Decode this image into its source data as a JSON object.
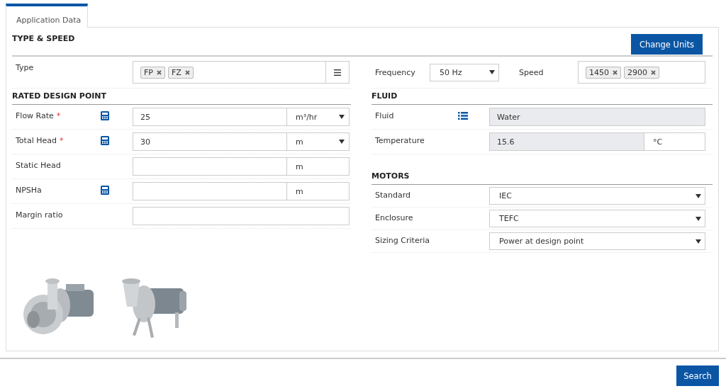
{
  "tabs": [
    {
      "label": "Application Data",
      "selected": true
    }
  ],
  "type_speed": {
    "heading": "TYPE & SPEED",
    "change_units_button": "Change Units",
    "type": {
      "label": "Type",
      "tags": [
        "FP",
        "FZ"
      ]
    },
    "frequency": {
      "label": "Frequency",
      "value": "50 Hz"
    },
    "speed": {
      "label": "Speed",
      "tags": [
        "1450",
        "2900"
      ]
    }
  },
  "rated_design_point": {
    "heading": "RATED DESIGN POINT",
    "rows": [
      {
        "label": "Flow Rate",
        "required_mark": "*",
        "calculator": true,
        "value": "25",
        "unit": "m³/hr",
        "unit_dropdown": true
      },
      {
        "label": "Total Head",
        "required_mark": "*",
        "calculator": true,
        "value": "30",
        "unit": "m",
        "unit_dropdown": true
      },
      {
        "label": "Static Head",
        "calculator": false,
        "unit": "m",
        "unit_dropdown": false
      },
      {
        "label": "NPSHa",
        "calculator": true,
        "unit": "m",
        "unit_dropdown": false
      },
      {
        "label": "Margin ratio",
        "calculator": false
      }
    ]
  },
  "fluid": {
    "heading": "FLUID",
    "rows": [
      {
        "label": "Fluid",
        "list_icon": true,
        "value": "Water",
        "disabled": true
      },
      {
        "label": "Temperature",
        "list_icon": false,
        "value": "15.6",
        "unit": "°C",
        "disabled": true
      }
    ]
  },
  "motors": {
    "heading": "MOTORS",
    "rows": [
      {
        "label": "Standard",
        "value": "IEC"
      },
      {
        "label": "Enclosure",
        "value": "TEFC"
      },
      {
        "label": "Sizing Criteria",
        "value": "Power at design point"
      }
    ]
  },
  "search_button": "Search"
}
